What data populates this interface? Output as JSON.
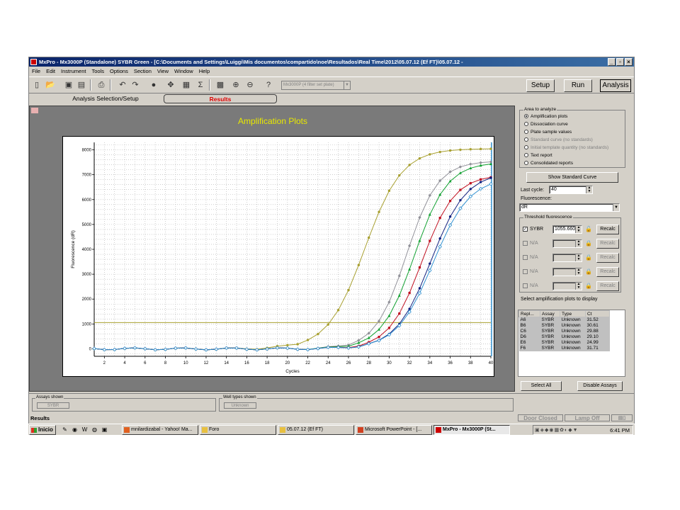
{
  "window": {
    "title": "MxPro - Mx3000P (Standalone) SYBR Green - [C:\\Documents and Settings\\Luiggi\\Mis documentos\\compartido\\noe\\Resultados\\Real Time\\2012\\05.07.12 (Ef FT)\\05.07.12 -",
    "controls": {
      "minimize": "_",
      "restore": "▫",
      "close": "×"
    }
  },
  "menu": [
    "File",
    "Edit",
    "Instrument",
    "Tools",
    "Options",
    "Section",
    "View",
    "Window",
    "Help"
  ],
  "toolbar": {
    "instrument_select": "Mx3000P (4 filter set plate)",
    "setup_label": "Setup",
    "run_label": "Run",
    "analysis_label": "Analysis"
  },
  "tabs": {
    "analysis_selection": "Analysis Selection/Setup",
    "results": "Results"
  },
  "plot": {
    "title": "Amplification Plots",
    "ylabel": "Fluorescence (dR)",
    "xlabel": "Cycles",
    "accent_title_color": "#e8e800"
  },
  "chart_data": {
    "type": "line",
    "title": "Amplification Plots",
    "xlabel": "Cycles",
    "ylabel": "Fluorescence (dR)",
    "xlim": [
      1,
      40
    ],
    "ylim": [
      -300,
      8300
    ],
    "xticks": [
      2,
      4,
      6,
      8,
      10,
      12,
      14,
      16,
      18,
      20,
      22,
      24,
      26,
      28,
      30,
      32,
      34,
      36,
      38,
      40
    ],
    "yticks": [
      0,
      1000,
      2000,
      3000,
      4000,
      5000,
      6000,
      7000,
      8000
    ],
    "grid": true,
    "threshold": 1055.66,
    "series": [
      {
        "name": "A6",
        "color": "#a8a030",
        "ct": 25.0,
        "plateau": 8050,
        "k": 0.55,
        "marker": "dot"
      },
      {
        "name": "B6",
        "color": "#909098",
        "ct": 29.1,
        "plateau": 7550,
        "k": 0.65,
        "marker": "diamond"
      },
      {
        "name": "C6",
        "color": "#10a030",
        "ct": 29.88,
        "plateau": 7500,
        "k": 0.62,
        "marker": "triangle"
      },
      {
        "name": "D6",
        "color": "#c01020",
        "ct": 30.61,
        "plateau": 7000,
        "k": 0.62,
        "marker": "square"
      },
      {
        "name": "E6",
        "color": "#102080",
        "ct": 31.52,
        "plateau": 7100,
        "k": 0.58,
        "marker": "dot"
      },
      {
        "name": "F6",
        "color": "#3090d0",
        "ct": 31.71,
        "plateau": 6900,
        "k": 0.56,
        "marker": "diamond-open"
      }
    ]
  },
  "area_to_analyze": {
    "title": "Area to analyze",
    "options": [
      {
        "label": "Amplification plots",
        "selected": true,
        "enabled": true
      },
      {
        "label": "Dissociation curve",
        "selected": false,
        "enabled": true
      },
      {
        "label": "Plate sample values",
        "selected": false,
        "enabled": true
      },
      {
        "label": "Standard curve (no standards)",
        "selected": false,
        "enabled": false
      },
      {
        "label": "Initial template quantity (no standards)",
        "selected": false,
        "enabled": false
      },
      {
        "label": "Text report",
        "selected": false,
        "enabled": true
      },
      {
        "label": "Consolidated reports",
        "selected": false,
        "enabled": true
      }
    ]
  },
  "controls": {
    "show_standard_curve": "Show Standard Curve",
    "last_cycle_label": "Last cycle:",
    "last_cycle_value": "40",
    "fluorescence_label": "Fluorescence:",
    "fluorescence_value": "dR",
    "threshold_title": "Threshold fluorescence",
    "threshold_rows": [
      {
        "dye": "SYBR",
        "value": "1055.660",
        "checked": true,
        "enabled": true
      },
      {
        "dye": "N/A",
        "value": "",
        "checked": false,
        "enabled": false
      },
      {
        "dye": "N/A",
        "value": "",
        "checked": false,
        "enabled": false
      },
      {
        "dye": "N/A",
        "value": "",
        "checked": false,
        "enabled": false
      },
      {
        "dye": "N/A",
        "value": "",
        "checked": false,
        "enabled": false
      }
    ],
    "recalc_label": "Recalc",
    "select_plots_label": "Select amplification plots to display",
    "select_all": "Select All",
    "disable_assays": "Disable Assays"
  },
  "amp_table": {
    "headers": [
      "Repl...",
      "Assay",
      "Type",
      "Ct"
    ],
    "rows": [
      [
        "A6",
        "SYBR",
        "Unknown",
        "31.52"
      ],
      [
        "B6",
        "SYBR",
        "Unknown",
        "30.61"
      ],
      [
        "C6",
        "SYBR",
        "Unknown",
        "29.88"
      ],
      [
        "D6",
        "SYBR",
        "Unknown",
        "29.10"
      ],
      [
        "E6",
        "SYBR",
        "Unknown",
        "24.99"
      ],
      [
        "F6",
        "SYBR",
        "Unknown",
        "31.71"
      ]
    ]
  },
  "bottom": {
    "assays_shown_label": "Assays shown",
    "assays_shown_value": "SYBR",
    "well_types_label": "Well types shown",
    "well_types_value": "Unknown"
  },
  "status": {
    "left": "Results",
    "door": "Door Closed",
    "lamp": "Lamp Off"
  },
  "taskbar": {
    "start": "Inicio",
    "tasks": [
      {
        "label": "mnilardizabal - Yahoo! Ma...",
        "active": false
      },
      {
        "label": "Foro",
        "active": false
      },
      {
        "label": "05.07.12 (Ef FT)",
        "active": false
      },
      {
        "label": "Microsoft PowerPoint - [...",
        "active": false
      },
      {
        "label": "MxPro - Mx3000P (St...",
        "active": true
      }
    ],
    "clock": "6:41 PM"
  }
}
